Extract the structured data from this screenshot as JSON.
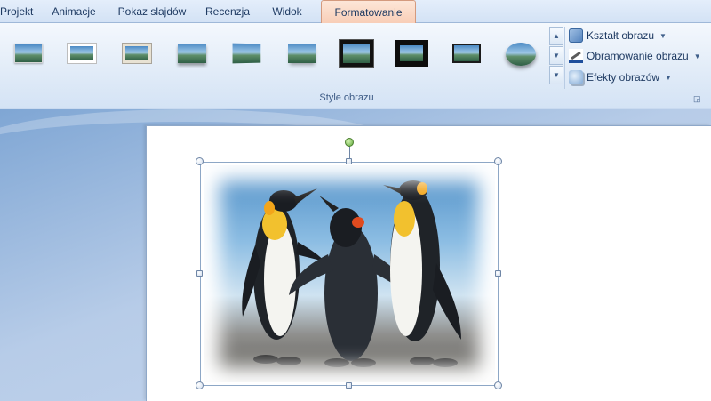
{
  "tabs": [
    {
      "label": "Projekt",
      "active": false
    },
    {
      "label": "Animacje",
      "active": false
    },
    {
      "label": "Pokaz slajdów",
      "active": false
    },
    {
      "label": "Recenzja",
      "active": false
    },
    {
      "label": "Widok",
      "active": false
    },
    {
      "label": "Formatowanie",
      "active": true
    }
  ],
  "ribbon": {
    "group_label": "Style obrazu",
    "commands": [
      {
        "label": "Kształt obrazu",
        "icon": "picture-shape-icon"
      },
      {
        "label": "Obramowanie obrazu",
        "icon": "picture-border-icon"
      },
      {
        "label": "Efekty obrazów",
        "icon": "picture-effects-icon"
      }
    ],
    "style_count": 10
  },
  "colors": {
    "active_tab": "#f8cdb6",
    "ribbon": "#e2ecf8",
    "rotation_handle": "#5ea83a"
  }
}
